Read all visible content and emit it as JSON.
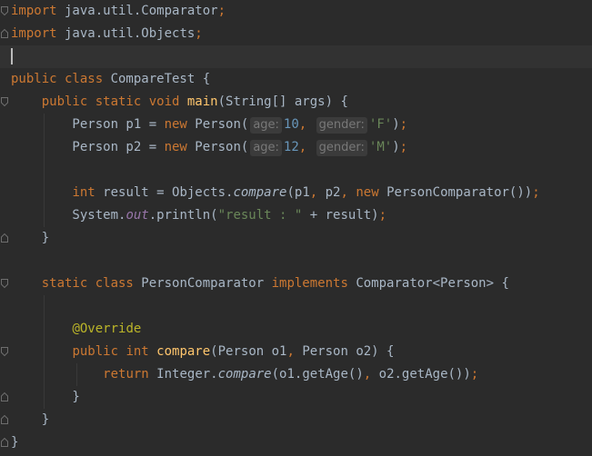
{
  "lines": [
    {
      "k": "l1",
      "parts": [
        [
          "kw",
          "import"
        ],
        [
          "t",
          " java.util.Comparator"
        ],
        [
          "kw",
          ";"
        ]
      ]
    },
    {
      "k": "l2",
      "parts": [
        [
          "kw",
          "import"
        ],
        [
          "t",
          " java.util.Objects"
        ],
        [
          "kw",
          ";"
        ]
      ]
    },
    {
      "k": "l3",
      "parts": []
    },
    {
      "k": "l4",
      "parts": [
        [
          "kw",
          "public class "
        ],
        [
          "t",
          "CompareTest {"
        ]
      ]
    },
    {
      "k": "l5",
      "parts": [
        [
          "t",
          "    "
        ],
        [
          "kw",
          "public static void "
        ],
        [
          "fn",
          "main"
        ],
        [
          "t",
          "(String[] args) {"
        ]
      ]
    },
    {
      "k": "l6",
      "parts": [
        [
          "t",
          "        Person p1 = "
        ],
        [
          "kw",
          "new "
        ],
        [
          "t",
          "Person("
        ],
        [
          "hint",
          "age:"
        ],
        [
          "num",
          "10"
        ],
        [
          "kw",
          ", "
        ],
        [
          "hint",
          "gender:"
        ],
        [
          "str",
          "'F'"
        ],
        [
          "t",
          ")"
        ],
        [
          "kw",
          ";"
        ]
      ]
    },
    {
      "k": "l7",
      "parts": [
        [
          "t",
          "        Person p2 = "
        ],
        [
          "kw",
          "new "
        ],
        [
          "t",
          "Person("
        ],
        [
          "hint",
          "age:"
        ],
        [
          "num",
          "12"
        ],
        [
          "kw",
          ", "
        ],
        [
          "hint",
          "gender:"
        ],
        [
          "str",
          "'M'"
        ],
        [
          "t",
          ")"
        ],
        [
          "kw",
          ";"
        ]
      ]
    },
    {
      "k": "l8",
      "parts": []
    },
    {
      "k": "l9",
      "parts": [
        [
          "t",
          "        "
        ],
        [
          "kw",
          "int "
        ],
        [
          "t",
          "result = Objects."
        ],
        [
          "ital",
          "compare"
        ],
        [
          "t",
          "(p1"
        ],
        [
          "kw",
          ", "
        ],
        [
          "t",
          "p2"
        ],
        [
          "kw",
          ", new "
        ],
        [
          "t",
          "PersonComparator())"
        ],
        [
          "kw",
          ";"
        ]
      ]
    },
    {
      "k": "l10",
      "parts": [
        [
          "t",
          "        System."
        ],
        [
          "field",
          "out"
        ],
        [
          "t",
          ".println("
        ],
        [
          "str",
          "\"result : \""
        ],
        [
          "t",
          " + result)"
        ],
        [
          "kw",
          ";"
        ]
      ]
    },
    {
      "k": "l11",
      "parts": [
        [
          "t",
          "    }"
        ]
      ]
    },
    {
      "k": "l12",
      "parts": []
    },
    {
      "k": "l13",
      "parts": [
        [
          "t",
          "    "
        ],
        [
          "kw",
          "static class "
        ],
        [
          "t",
          "PersonComparator "
        ],
        [
          "kw",
          "implements "
        ],
        [
          "t",
          "Comparator<Person> {"
        ]
      ]
    },
    {
      "k": "l14",
      "parts": []
    },
    {
      "k": "l15",
      "parts": [
        [
          "t",
          "        "
        ],
        [
          "ann",
          "@Override"
        ]
      ]
    },
    {
      "k": "l16",
      "parts": [
        [
          "t",
          "        "
        ],
        [
          "kw",
          "public int "
        ],
        [
          "fn",
          "compare"
        ],
        [
          "t",
          "(Person o1"
        ],
        [
          "kw",
          ", "
        ],
        [
          "t",
          "Person o2) {"
        ]
      ]
    },
    {
      "k": "l17",
      "parts": [
        [
          "t",
          "            "
        ],
        [
          "kw",
          "return "
        ],
        [
          "t",
          "Integer."
        ],
        [
          "ital",
          "compare"
        ],
        [
          "t",
          "(o1.getAge()"
        ],
        [
          "kw",
          ", "
        ],
        [
          "t",
          "o2.getAge())"
        ],
        [
          "kw",
          ";"
        ]
      ]
    },
    {
      "k": "l18",
      "parts": [
        [
          "t",
          "        }"
        ]
      ]
    },
    {
      "k": "l19",
      "parts": [
        [
          "t",
          "    }"
        ]
      ]
    },
    {
      "k": "l20",
      "parts": [
        [
          "t",
          "}"
        ]
      ]
    }
  ],
  "current_line": 3,
  "fold_markers": [
    {
      "line": 1,
      "type": "open",
      "icon": "fold-open-icon"
    },
    {
      "line": 2,
      "type": "close",
      "icon": "fold-close-icon"
    },
    {
      "line": 5,
      "type": "open",
      "icon": "fold-open-icon"
    },
    {
      "line": 11,
      "type": "close",
      "icon": "fold-close-icon"
    },
    {
      "line": 13,
      "type": "open",
      "icon": "fold-open-icon"
    },
    {
      "line": 16,
      "type": "open",
      "icon": "fold-open-icon"
    },
    {
      "line": 18,
      "type": "close",
      "icon": "fold-close-icon"
    },
    {
      "line": 19,
      "type": "close",
      "icon": "fold-close-icon"
    },
    {
      "line": 20,
      "type": "close",
      "icon": "fold-close-icon"
    }
  ],
  "colors": {
    "background": "#2b2b2b",
    "current_line": "#323232",
    "text": "#a9b7c6",
    "keyword": "#cc7832",
    "function": "#ffc66d",
    "string": "#6a8759",
    "number": "#6897bb",
    "annotation": "#bbb529",
    "field": "#9876aa",
    "hint_bg": "#3b3b3b",
    "hint_text": "#787878"
  }
}
